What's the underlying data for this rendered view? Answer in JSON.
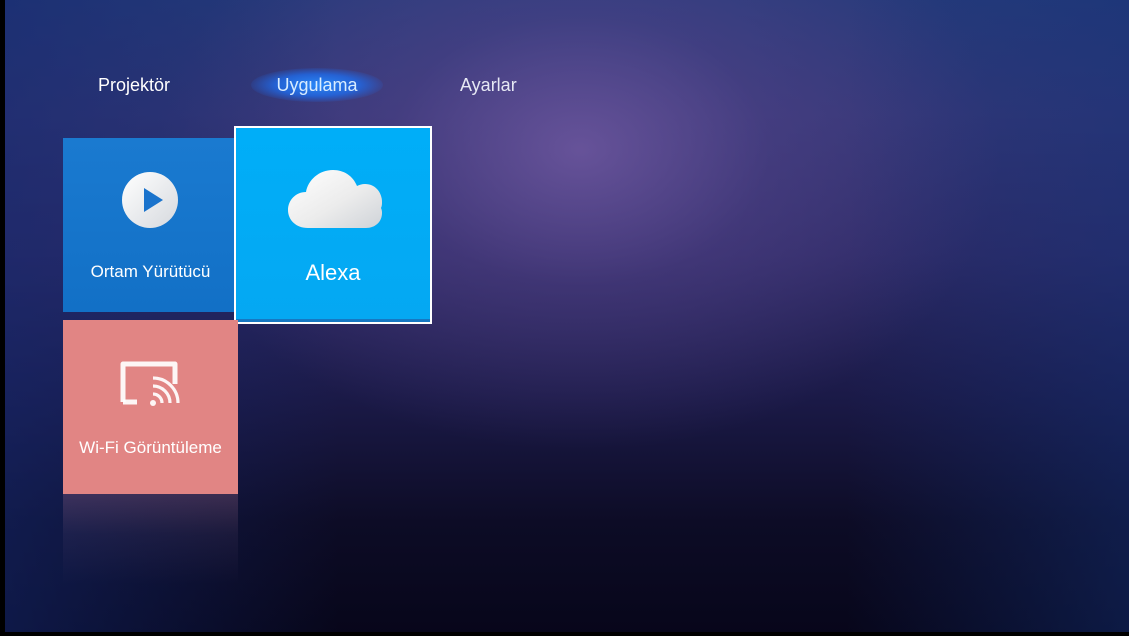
{
  "nav": {
    "tabs": [
      {
        "label": "Projektör",
        "selected": false
      },
      {
        "label": "Uygulama",
        "selected": true
      },
      {
        "label": "Ayarlar",
        "selected": false
      }
    ]
  },
  "tiles": {
    "media_player": {
      "label": "Ortam Yürütücü",
      "icon": "play-icon",
      "color": "#1572c8"
    },
    "alexa": {
      "label": "Alexa",
      "icon": "cloud-icon",
      "color": "#00aef8",
      "focused": true
    },
    "wifi_display": {
      "label": "Wi-Fi Görüntüleme",
      "icon": "cast-icon",
      "color": "#e18584"
    }
  },
  "colors": {
    "focus_outline": "#ffffff",
    "selected_tab_glow": "#2a8cff"
  }
}
